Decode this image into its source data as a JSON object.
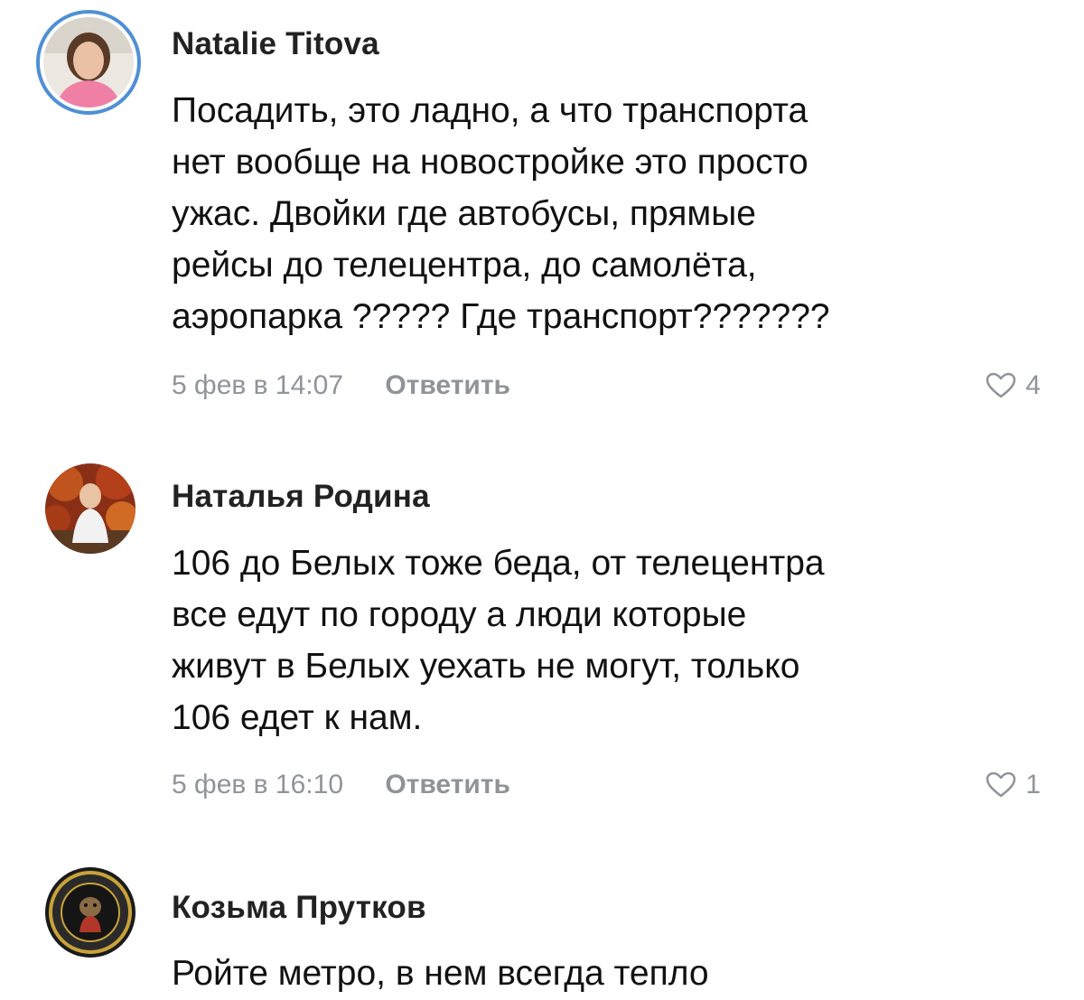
{
  "comments": [
    {
      "author": "Natalie Titova",
      "lines": [
        "Посадить, это ладно, а что транспорта",
        "нет вообще на новостройке это просто",
        "ужас. Двойки где автобусы, прямые",
        "рейсы до телецентра, до самолёта,",
        "аэропарка ????? Где транспорт???????"
      ],
      "date": "5 фев в 14:07",
      "reply_label": "Ответить",
      "likes": "4",
      "like_icon": "heart-outline-icon",
      "has_story_ring": true
    },
    {
      "author": "Наталья Родина",
      "lines": [
        "106 до Белых тоже беда, от телецентра",
        "все едут по городу а люди которые",
        "живут в Белых уехать не могут, только",
        "106 едет к нам."
      ],
      "date": "5 фев в 16:10",
      "reply_label": "Ответить",
      "likes": "1",
      "like_icon": "heart-outline-icon",
      "has_story_ring": false
    },
    {
      "author": "Козьма Прутков",
      "lines": [
        "Ройте метро, в нем всегда тепло"
      ],
      "has_story_ring": false
    }
  ],
  "colors": {
    "meta_gray": "#909499",
    "story_ring_blue": "#4f8fd6",
    "author_text": "#222222"
  }
}
